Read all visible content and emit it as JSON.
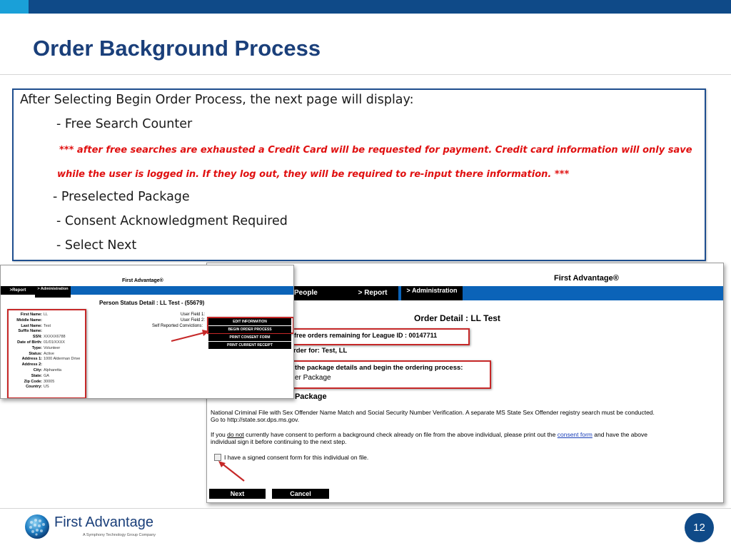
{
  "slide": {
    "title": "Order Background Process",
    "page_number": "12"
  },
  "textbox": {
    "intro": "After Selecting Begin Order Process, the next page will display:",
    "item1": "- Free Search Counter",
    "note_line1": "*** after free searches are exhausted a Credit Card will be requested for payment. Credit card information will only save",
    "note_line2": "while the user is logged in.  If they log out, they will be required to re-input there information. ***",
    "item2": "- Preselected Package",
    "item3": "- Consent Acknowledgment Required",
    "item4": "- Select Next"
  },
  "shot1": {
    "brand": "First Advantage®",
    "nav": [
      ">Report",
      "> Administration"
    ],
    "heading": "Person Status Detail : LL Test - (55679)",
    "fields": [
      {
        "label": "First Name:",
        "value": "LL"
      },
      {
        "label": "Middle Name:",
        "value": ""
      },
      {
        "label": "Last Name:",
        "value": "Test"
      },
      {
        "label": "Suffix Name:",
        "value": ""
      },
      {
        "label": "SSN:",
        "value": "XXXXX6788"
      },
      {
        "label": "Date of Birth:",
        "value": "01/01/XXXX"
      },
      {
        "label": "Type:",
        "value": "Volunteer"
      },
      {
        "label": "Status:",
        "value": "Active"
      },
      {
        "label": "Address 1:",
        "value": "1000 Alderman Drive"
      },
      {
        "label": "Address 2:",
        "value": ""
      },
      {
        "label": "City:",
        "value": "Alpharetta"
      },
      {
        "label": "State:",
        "value": "GA"
      },
      {
        "label": "Zip Code:",
        "value": "30005"
      },
      {
        "label": "Country:",
        "value": "US"
      }
    ],
    "user_fields": [
      "User Field 1:",
      "User Field 2:",
      "Self Reported Convictions:"
    ],
    "menu": [
      "EDIT INFORMATION",
      "BEGIN ORDER PROCESS",
      "PRINT CONSENT FORM",
      "PRINT CURRENT RECEIPT"
    ]
  },
  "shot2": {
    "brand": "First Advantage®",
    "nav": [
      "People",
      "> Report",
      "> Administration"
    ],
    "heading": "Order Detail : LL Test",
    "free_orders": "free orders remaining for League ID : 00147711",
    "order_for": "rder for: Test, LL",
    "package_prompt": "the package details and begin the ordering process:",
    "package_name": "er Package",
    "package_heading": "nteer Package",
    "desc1": "National Criminal File with Sex Offender Name Match and Social Security Number Verification. A separate MS State Sex Offender registry search must be conducted.",
    "desc2": "Go to http://state.sor.dps.ms.gov.",
    "consent1_pre": "If you ",
    "consent1_do_not": "do not",
    "consent1_mid": " currently have consent to perform a background check already on file from the above individual, please print out the ",
    "consent1_link": "consent form",
    "consent1_post": " and have the above",
    "consent2": "individual sign it before continuing to the next step.",
    "checkbox_label": "I have a signed consent form for this individual on file.",
    "next_label": "Next",
    "cancel_label": "Cancel"
  },
  "footer": {
    "logo_name": "First Advantage",
    "logo_tagline": "A Symphony Technology Group Company"
  },
  "colors": {
    "brand_navy": "#0f4a88",
    "accent_cyan": "#1aa0d8",
    "title_blue": "#1a3f7a",
    "red_note": "#e01010",
    "nav_blue": "#0b63b8"
  }
}
